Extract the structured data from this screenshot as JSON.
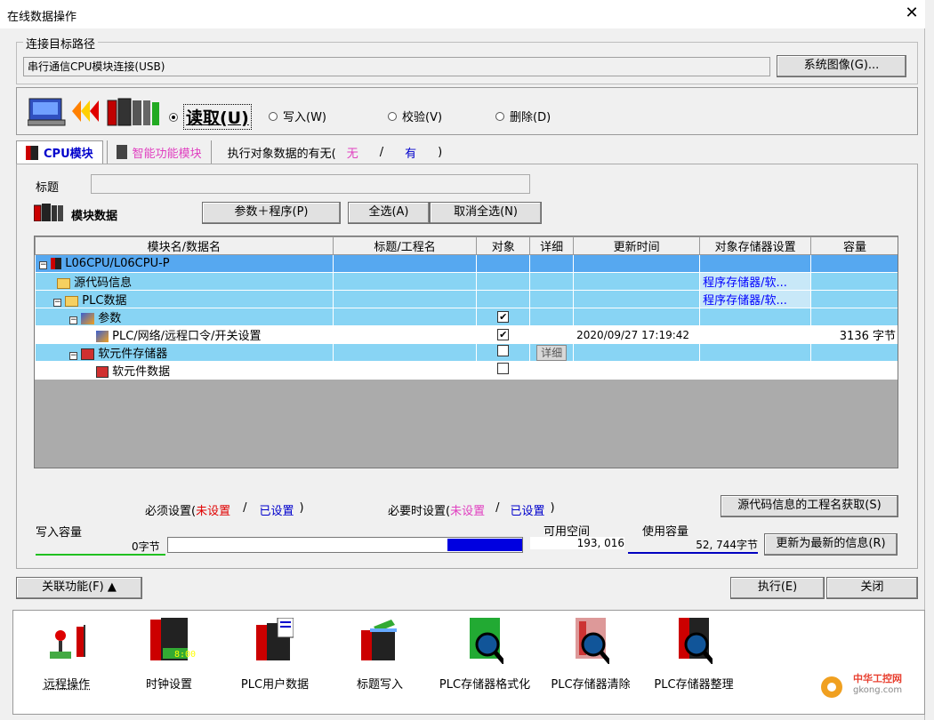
{
  "window": {
    "title": "在线数据操作"
  },
  "connection": {
    "group_label": "连接目标路径",
    "path": "串行通信CPU模块连接(USB)",
    "system_image_button": "系统图像(G)..."
  },
  "mode": {
    "read": "读取(U)",
    "write": "写入(W)",
    "verify": "校验(V)",
    "delete": "删除(D)",
    "selected": "read"
  },
  "tabs": {
    "cpu": "CPU模块",
    "intelligent": "智能功能模块",
    "exists_label": "执行对象数据的有无(",
    "none": "无",
    "slash": "/",
    "has": "有",
    "close_paren": ")"
  },
  "caption": {
    "label": "标题",
    "value": ""
  },
  "module_data": {
    "label": "模块数据",
    "param_prog_button": "参数＋程序(P)",
    "select_all_button": "全选(A)",
    "deselect_all_button": "取消全选(N)"
  },
  "grid": {
    "headers": [
      "模块名/数据名",
      "标题/工程名",
      "对象",
      "详细",
      "更新时间",
      "对象存储器设置",
      "容量"
    ],
    "rows": [
      {
        "name": "L06CPU/L06CPU-P",
        "title": "",
        "target": "",
        "detail": "",
        "time": "",
        "storage": "",
        "size": ""
      },
      {
        "name": "源代码信息",
        "title": "",
        "target": "",
        "detail": "",
        "time": "",
        "storage": "程序存储器/软...",
        "size": ""
      },
      {
        "name": "PLC数据",
        "title": "",
        "target": "",
        "detail": "",
        "time": "",
        "storage": "程序存储器/软...",
        "size": ""
      },
      {
        "name": "参数",
        "title": "",
        "target": "✔",
        "detail": "",
        "time": "",
        "storage": "",
        "size": ""
      },
      {
        "name": "PLC/网络/远程口令/开关设置",
        "title": "",
        "target": "✔",
        "detail": "",
        "time": "2020/09/27 17:19:42",
        "storage": "",
        "size": "3136 字节"
      },
      {
        "name": "软元件存储器",
        "title": "",
        "target": "",
        "detail": "详细",
        "time": "",
        "storage": "",
        "size": ""
      },
      {
        "name": "软元件数据",
        "title": "",
        "target": "",
        "detail": "",
        "time": "",
        "storage": "",
        "size": ""
      }
    ]
  },
  "status": {
    "required_label": "必须设置(",
    "not_set": "未设置",
    "slash": "/",
    "set": "已设置",
    "close_paren": ")",
    "optional_label": "必要时设置(",
    "source_name_button": "源代码信息的工程名获取(S)",
    "write_capacity_label": "写入容量",
    "write_capacity_value": "0字节",
    "free_space_label": "可用空间",
    "free_space_value": "193, 016",
    "used_label": "使用容量",
    "used_value": "52, 744字节",
    "refresh_button": "更新为最新的信息(R)",
    "progress_fraction": 0.21
  },
  "footer": {
    "related_button": "关联功能(F) ▲",
    "execute_button": "执行(E)",
    "close_button": "关闭"
  },
  "related_functions": [
    "远程操作",
    "时钟设置",
    "PLC用户数据",
    "标题写入",
    "PLC存储器格式化",
    "PLC存储器清除",
    "PLC存储器整理"
  ],
  "clock_display": "8:00",
  "watermark": {
    "line1": "中华工控网",
    "line2": "gkong.com"
  }
}
